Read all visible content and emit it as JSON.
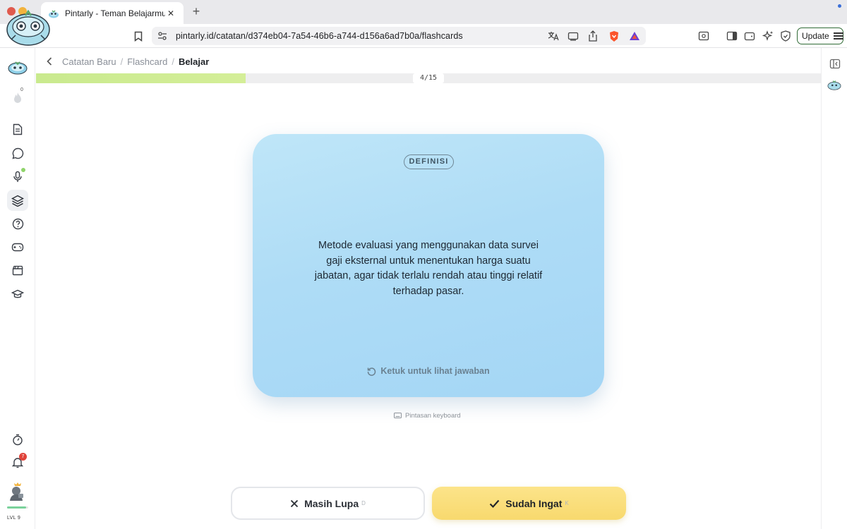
{
  "browser": {
    "tab_title": "Pintarly - Teman Belajarmu",
    "new_tab_symbol": "+",
    "close_symbol": "✕",
    "url_host": "pintarly.id",
    "url_path": "/catatan/d374eb04-7a54-46b6-a744-d156a6ad7b0a/flashcards",
    "update_label": "Update"
  },
  "breadcrumb": {
    "items": [
      "Catatan Baru",
      "Flashcard"
    ],
    "current": "Belajar",
    "separator": "/"
  },
  "progress": {
    "label": "4/15",
    "current": 4,
    "total": 15
  },
  "card": {
    "badge": "DEFINISI",
    "text": "Metode evaluasi yang menggunakan data survei gaji eksternal untuk menentukan harga suatu jabatan, agar tidak terlalu rendah atau tinggi relatif terhadap pasar.",
    "hint": "Ketuk untuk lihat jawaban"
  },
  "keyboard_shortcuts_label": "Pintasan keyboard",
  "actions": {
    "forgot_label": "Masih Lupa",
    "forgot_key": "D",
    "remember_label": "Sudah Ingat",
    "remember_key": "K"
  },
  "sidebar": {
    "streak_count": "0",
    "notification_count": "7",
    "level_label": "LVL 9",
    "level_progress": 0.9,
    "items": [
      "notes-icon",
      "chat-icon",
      "microphone-icon",
      "flashcard-layers-icon",
      "help-icon",
      "game-controller-icon",
      "video-clapper-icon",
      "graduation-cap-icon"
    ]
  },
  "colors": {
    "card_bg": "#aedcf6",
    "progress_fill": "#c9ea8e",
    "remember_button": "#f8d96e",
    "update_border": "#2f6a35",
    "badge_red": "#e0433a"
  }
}
